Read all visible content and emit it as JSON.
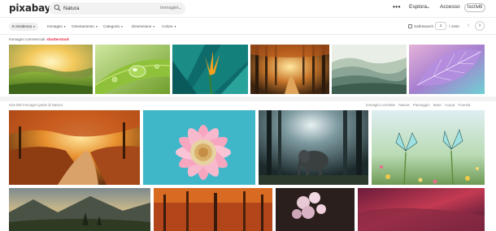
{
  "header": {
    "logo": "pixabay",
    "search_query": "Natura",
    "search_scope": "Immagini",
    "search_scope_chev": "⌄",
    "more": "•••",
    "explore": "Esplora",
    "explore_chev": "⌄",
    "login": "Accesso",
    "signup": "Iscriviti"
  },
  "filters": {
    "trending": "In tendenza",
    "items": [
      "Immagini",
      "Orientamento",
      "Categoria",
      "Dimensione",
      "Colore"
    ],
    "chev": "▾",
    "safesearch": "SafeSearch",
    "page_current": "1",
    "page_total": "/ 4260",
    "prev": "‹",
    "next": "›"
  },
  "sponsored": {
    "label": "Immagini commerciali",
    "brand": "shutterstock"
  },
  "results": {
    "count_label": "424.000 Immagini gratis di Natura",
    "related_label": "Immagini correlate",
    "related_tags": [
      "Natura",
      "Paesaggio",
      "Mare",
      "Acqua",
      "Foresta"
    ]
  },
  "image_labels": {
    "s1": "green hills sunrise",
    "s2": "leaf water drop",
    "s3": "tropical leaves bird of paradise",
    "s4": "autumn forest path",
    "s5": "misty mountains",
    "s6": "purple leaf",
    "r1": "autumn forest road",
    "r2": "pink flower",
    "r3": "elephant in forest",
    "r4": "butterflies on flowers",
    "b1": "trees mountain valley",
    "b2": "red autumn forest",
    "b3": "pink flowers vase",
    "b4": "red purple sky"
  }
}
